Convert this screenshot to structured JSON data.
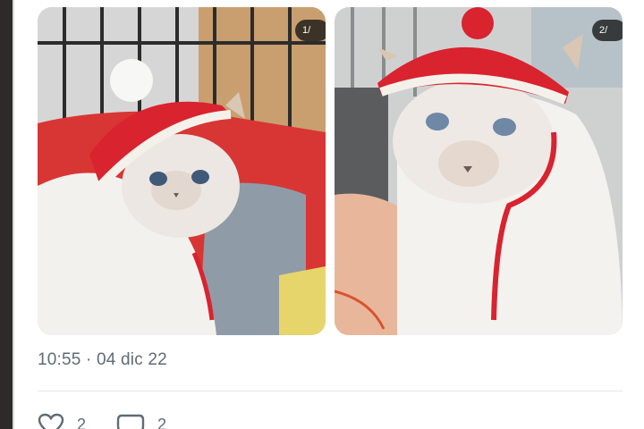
{
  "tweet": {
    "media": [
      {
        "label": "cat-photo-1",
        "badge": "1/"
      },
      {
        "label": "cat-photo-2",
        "badge": "2/"
      }
    ],
    "timestamp": "10:55 · 04 dic 22",
    "actions": {
      "likes_count": "2",
      "replies_count": "2"
    }
  },
  "icons": {
    "like": "heart-icon",
    "reply": "comment-icon"
  },
  "colors": {
    "hat_red": "#d9232f",
    "text_secondary": "#5f6b75"
  }
}
